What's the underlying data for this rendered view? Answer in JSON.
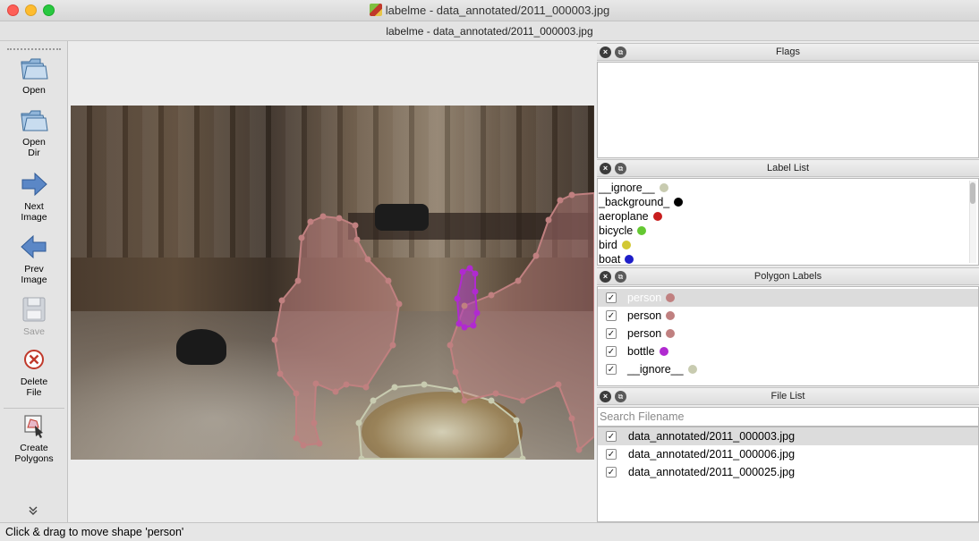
{
  "window": {
    "title": "labelme - data_annotated/2011_000003.jpg",
    "subtitle": "labelme - data_annotated/2011_000003.jpg"
  },
  "toolbar": {
    "open": "Open",
    "open_dir": "Open\nDir",
    "next_image": "Next\nImage",
    "prev_image": "Prev\nImage",
    "save": "Save",
    "delete_file": "Delete\nFile",
    "create_polygons": "Create\nPolygons",
    "more": "»"
  },
  "panels": {
    "flags": {
      "title": "Flags"
    },
    "label_list": {
      "title": "Label List",
      "items": [
        {
          "label": "__ignore__",
          "color": "#c8cbb0"
        },
        {
          "label": "_background_",
          "color": "#000000"
        },
        {
          "label": "aeroplane",
          "color": "#c81e1e"
        },
        {
          "label": "bicycle",
          "color": "#64c832"
        },
        {
          "label": "bird",
          "color": "#d2c832"
        },
        {
          "label": "boat",
          "color": "#1e1ec8"
        }
      ]
    },
    "polygon_labels": {
      "title": "Polygon Labels",
      "items": [
        {
          "label": "person",
          "color": "#c08080",
          "checked": true,
          "selected": true
        },
        {
          "label": "person",
          "color": "#c08080",
          "checked": true,
          "selected": false
        },
        {
          "label": "person",
          "color": "#c08080",
          "checked": true,
          "selected": false
        },
        {
          "label": "bottle",
          "color": "#b02ad0",
          "checked": true,
          "selected": false
        },
        {
          "label": "__ignore__",
          "color": "#c8cbb0",
          "checked": true,
          "selected": false
        }
      ]
    },
    "file_list": {
      "title": "File List",
      "search_placeholder": "Search Filename",
      "items": [
        {
          "name": "data_annotated/2011_000003.jpg",
          "checked": true,
          "selected": true
        },
        {
          "name": "data_annotated/2011_000006.jpg",
          "checked": true,
          "selected": false
        },
        {
          "name": "data_annotated/2011_000025.jpg",
          "checked": true,
          "selected": false
        }
      ]
    }
  },
  "status": {
    "text": "Click & drag to move shape 'person'"
  }
}
